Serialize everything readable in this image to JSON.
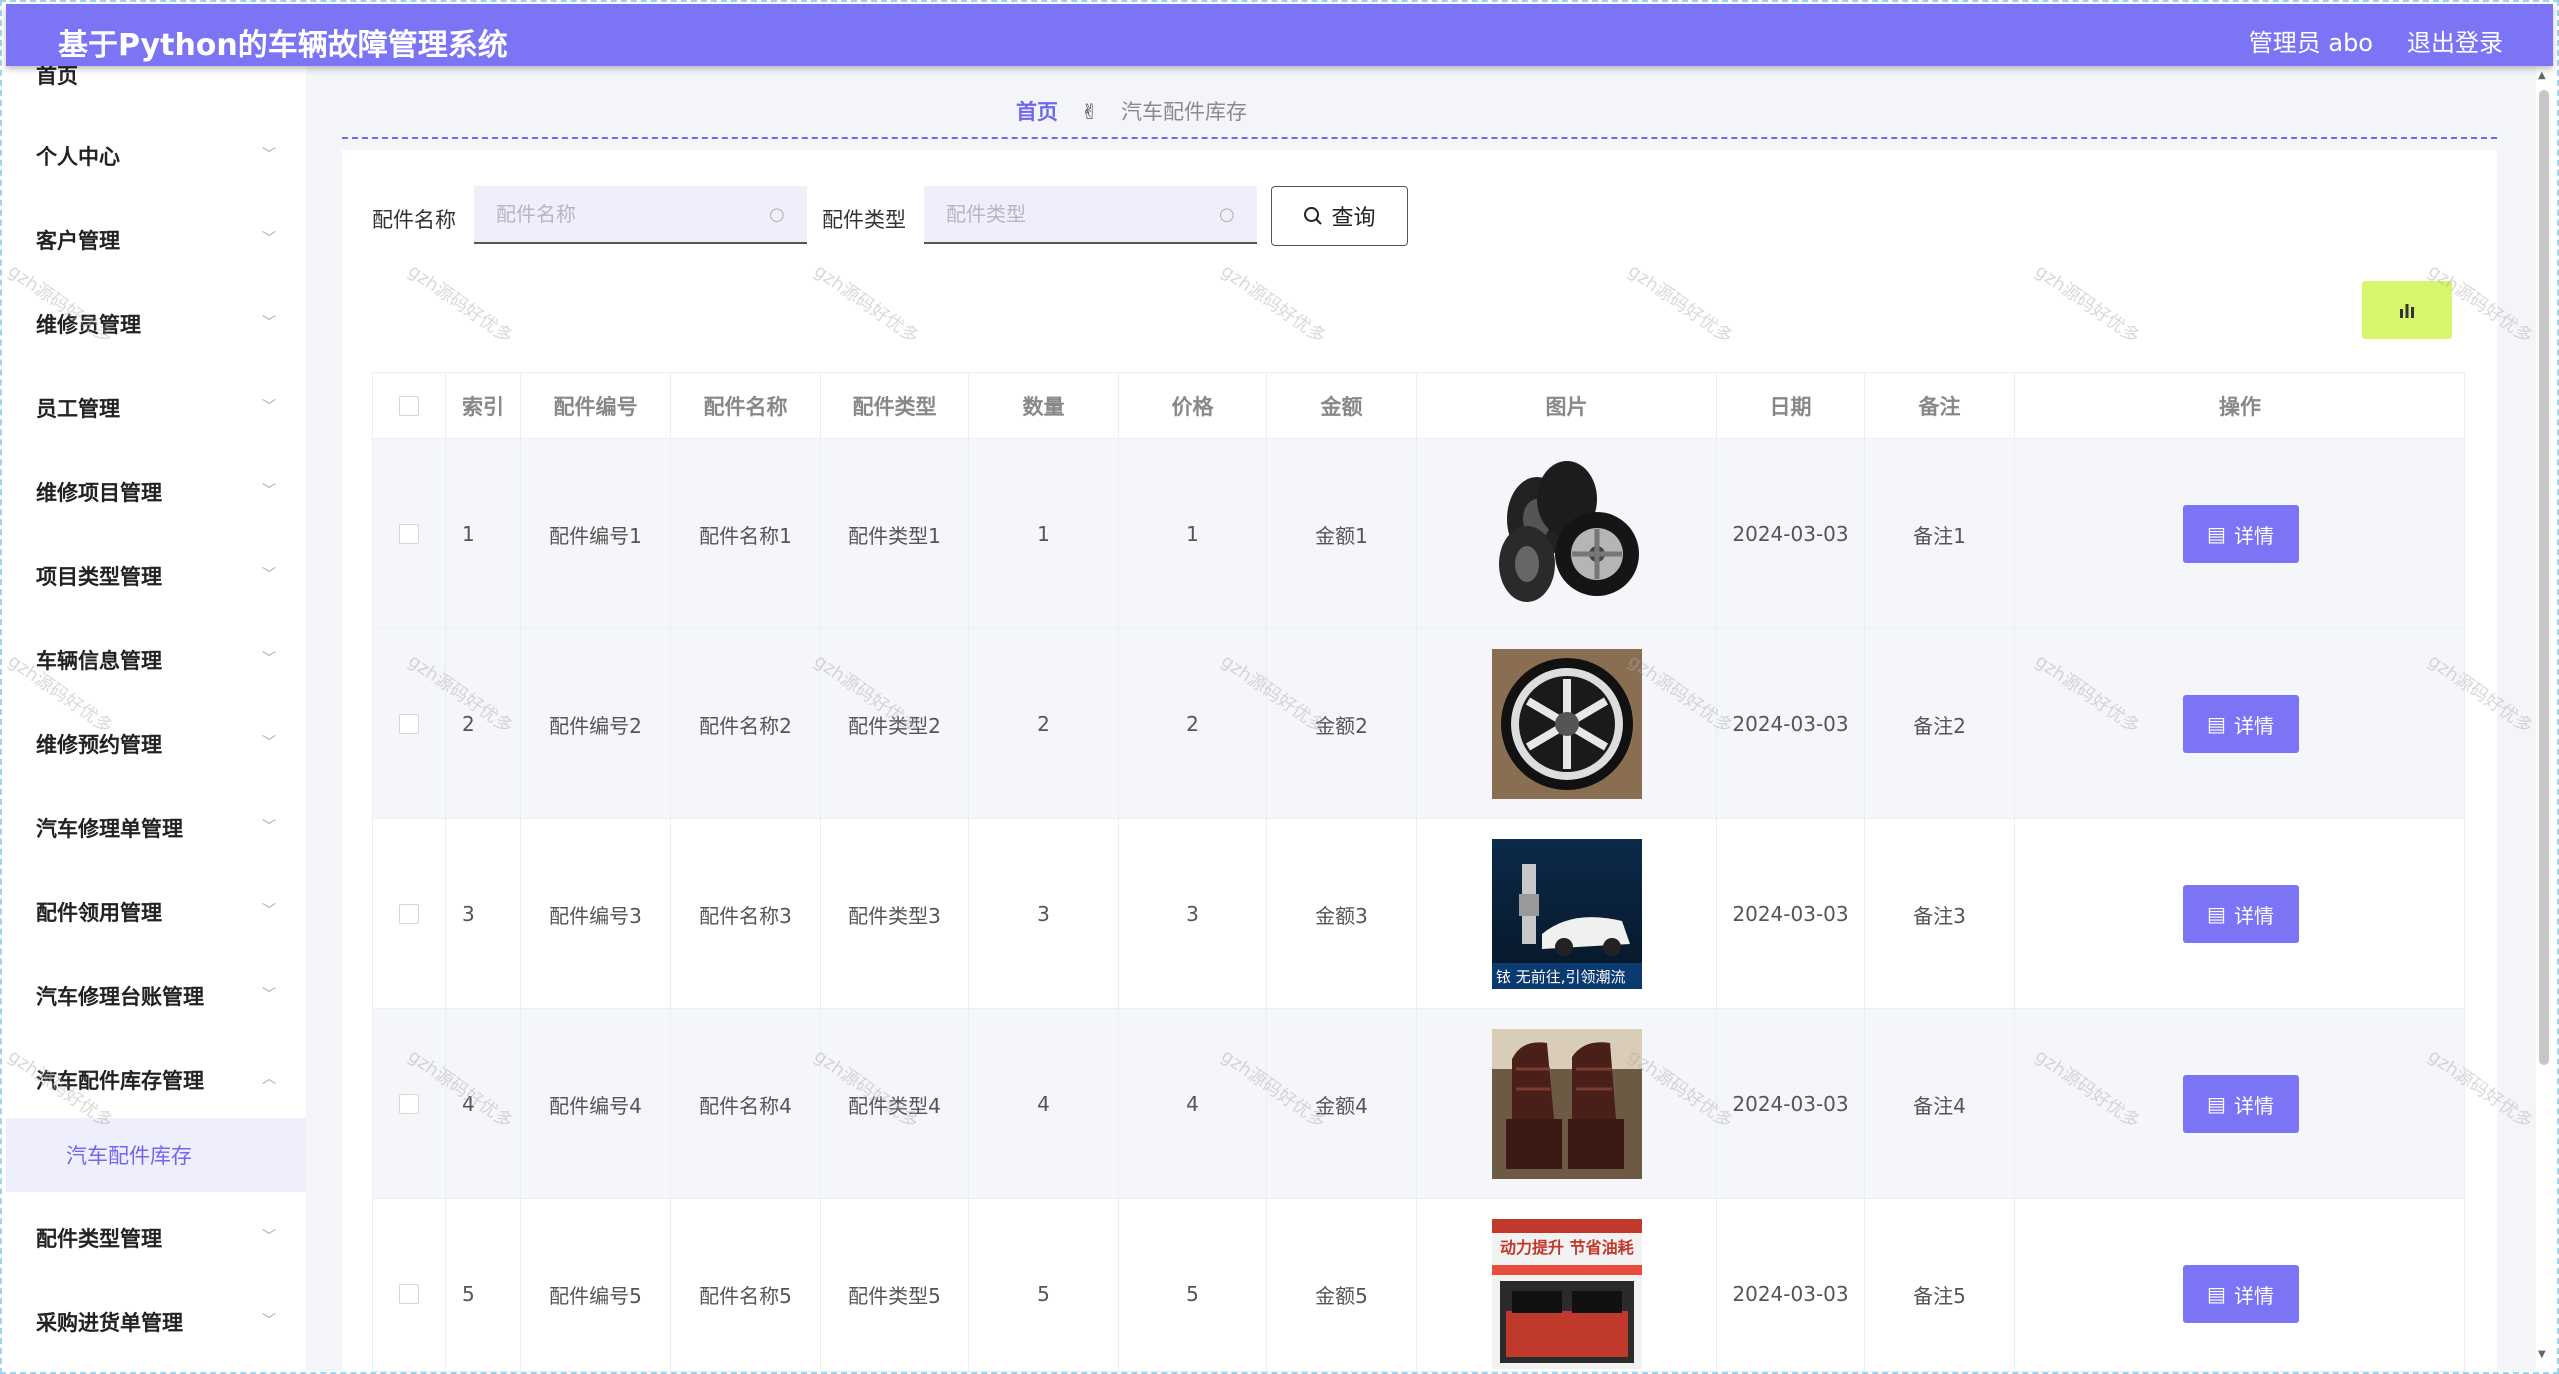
{
  "header": {
    "title": "基于Python的车辆故障管理系统",
    "user": "管理员 abo",
    "logout": "退出登录"
  },
  "sidebar": {
    "top_item": "首页",
    "items": [
      {
        "label": "个人中心"
      },
      {
        "label": "客户管理"
      },
      {
        "label": "维修员管理"
      },
      {
        "label": "员工管理"
      },
      {
        "label": "维修项目管理"
      },
      {
        "label": "项目类型管理"
      },
      {
        "label": "车辆信息管理"
      },
      {
        "label": "维修预约管理"
      },
      {
        "label": "汽车修理单管理"
      },
      {
        "label": "配件领用管理"
      },
      {
        "label": "汽车修理台账管理"
      },
      {
        "label": "汽车配件库存管理"
      },
      {
        "label": "配件类型管理"
      },
      {
        "label": "采购进货单管理"
      }
    ],
    "active_sub": "汽车配件库存"
  },
  "breadcrumb": {
    "home": "首页",
    "separator_icon": "hand-peace-icon",
    "current": "汽车配件库存"
  },
  "search": {
    "name_label": "配件名称",
    "name_placeholder": "配件名称",
    "type_label": "配件类型",
    "type_placeholder": "配件类型",
    "query_label": "查询"
  },
  "chart_button_color": "#d7f66b",
  "table": {
    "columns": [
      "索引",
      "配件编号",
      "配件名称",
      "配件类型",
      "数量",
      "价格",
      "金额",
      "图片",
      "日期",
      "备注",
      "操作"
    ],
    "rows": [
      {
        "index": "1",
        "code": "配件编号1",
        "name": "配件名称1",
        "type": "配件类型1",
        "qty": "1",
        "price": "1",
        "amount": "金额1",
        "image": "tires-photo",
        "date": "2024-03-03",
        "note": "备注1",
        "action": "详情"
      },
      {
        "index": "2",
        "code": "配件编号2",
        "name": "配件名称2",
        "type": "配件类型2",
        "qty": "2",
        "price": "2",
        "amount": "金额2",
        "image": "wheel-rim-photo",
        "date": "2024-03-03",
        "note": "备注2",
        "action": "详情"
      },
      {
        "index": "3",
        "code": "配件编号3",
        "name": "配件名称3",
        "type": "配件类型3",
        "qty": "3",
        "price": "3",
        "amount": "金额3",
        "image": "spark-plug-car-photo",
        "image_caption": "铱 无前往,引领潮流",
        "date": "2024-03-03",
        "note": "备注3",
        "action": "详情"
      },
      {
        "index": "4",
        "code": "配件编号4",
        "name": "配件名称4",
        "type": "配件类型4",
        "qty": "4",
        "price": "4",
        "amount": "金额4",
        "image": "seat-cover-photo",
        "date": "2024-03-03",
        "note": "备注4",
        "action": "详情"
      },
      {
        "index": "5",
        "code": "配件编号5",
        "name": "配件名称5",
        "type": "配件类型5",
        "qty": "5",
        "price": "5",
        "amount": "金额5",
        "image": "fuel-saver-photo",
        "image_caption": "动力提升 节省油耗",
        "date": "2024-03-03",
        "note": "备注5",
        "action": "详情"
      }
    ]
  },
  "watermark": "gzh源码好优多"
}
